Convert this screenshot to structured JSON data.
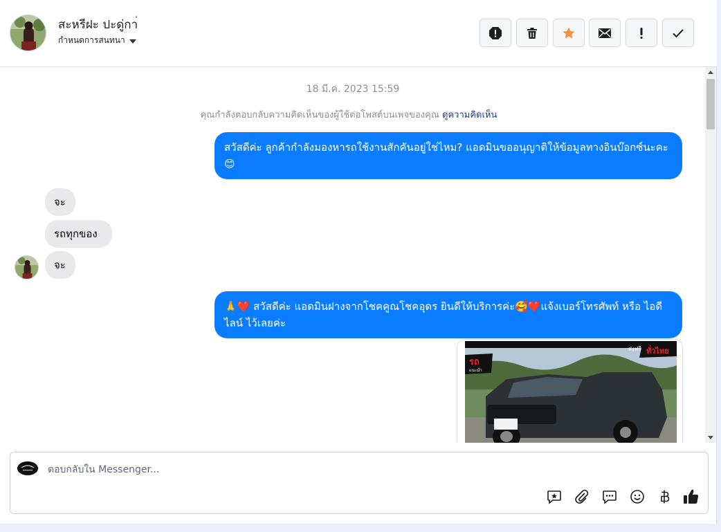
{
  "header": {
    "contact_name": "สะหรีฝะ ปะดู่กา่",
    "conversation_settings_label": "กำหนดการสนทนา",
    "actions": [
      {
        "name": "report-spam-button",
        "icon": "alert-circle-icon"
      },
      {
        "name": "delete-button",
        "icon": "trash-icon"
      },
      {
        "name": "star-button",
        "icon": "star-icon"
      },
      {
        "name": "mark-unread-button",
        "icon": "envelope-icon"
      },
      {
        "name": "follow-up-button",
        "icon": "exclamation-icon"
      },
      {
        "name": "mark-done-button",
        "icon": "check-icon"
      }
    ]
  },
  "thread": {
    "date_separator": "18 มี.ค. 2023 15:59",
    "reply_note": "คุณกำลังตอบกลับความคิดเห็นของผู้ใช้ต่อโพสต์บนเพจของคุณ",
    "view_comment_link": "ดูความคิดเห็น",
    "messages": [
      {
        "direction": "out",
        "text": "สวัสดีค่ะ ลูกค้ากำลังมองหารถใช้งานสักคันอยู่ใช่ไหม? แอดมินขออนุญาติให้ข้อมูลทางอินบ๊อกซ์นะคะ 😊"
      },
      {
        "direction": "in",
        "text": "จะ"
      },
      {
        "direction": "in",
        "text": "รถทุกของ"
      },
      {
        "direction": "in",
        "text": "จะ"
      },
      {
        "direction": "out",
        "text": "🙏❤️ สวัสดีค่ะ แอดมินฝางจากโชคคูณโชคอุดร ยินดีให้บริการค่ะ🥰❤️แจ้งเบอร์โทรศัพท์ หรือ ไอดีไลน์  ไว้เลยค่ะ"
      }
    ],
    "image_card": {
      "badge_text": "ส่งฟรี",
      "badge_text_red": "ทั่วไทย",
      "logo_text": "รถ",
      "logo_sub": "แนะนำ"
    }
  },
  "composer": {
    "placeholder": "ตอบกลับใน Messenger...",
    "icons": [
      "saved-reply-icon",
      "attachment-icon",
      "chat-bubble-icon",
      "emoji-icon",
      "baht-icon",
      "thumbs-up-icon"
    ]
  },
  "colors": {
    "accent": "#0a7cff",
    "incoming_bubble": "#e9e9eb",
    "star": "#f7923a"
  }
}
